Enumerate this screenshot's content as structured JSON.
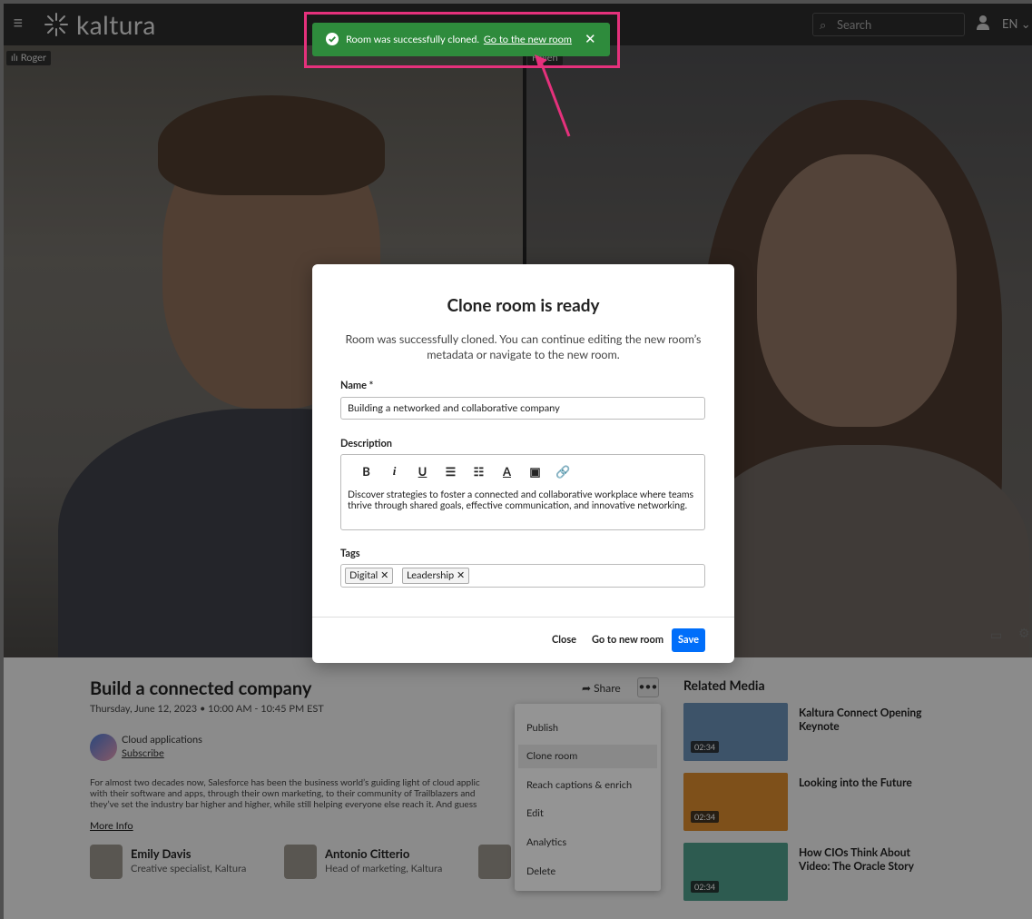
{
  "header": {
    "logo_text": "kaltura",
    "search_placeholder": "Search",
    "language": "EN"
  },
  "video": {
    "left_participant": "Roger",
    "right_participant": "Helen"
  },
  "details": {
    "title": "Build a connected company",
    "date": "Thursday, June 12, 2023  •  10:00 AM - 10:45 PM EST",
    "channel_name": "Cloud applications",
    "subscribe_label": "Subscribe",
    "description_lines": [
      "For almost two decades now, Salesforce has been the business world’s guiding light of cloud applic",
      "with their software and apps, through their own marketing, to their community of Trailblazers and",
      "they’ve set the industry bar higher and higher, while still helping everyone else reach it. And guess"
    ],
    "more_info": "More Info",
    "share_label": "Share",
    "more_label": "•••",
    "people": [
      {
        "name": "Emily Davis",
        "role": "Creative specialist, Kaltura"
      },
      {
        "name": "Antonio Citterio",
        "role": "Head of marketing, Kaltura"
      }
    ]
  },
  "related": {
    "title": "Related Media",
    "items": [
      {
        "title": "Kaltura Connect Opening Keynote",
        "duration": "02:34",
        "color": "#6a8fb5"
      },
      {
        "title": "Looking into the Future",
        "duration": "02:34",
        "color": "#d98a2e"
      },
      {
        "title": "How CIOs Think About Video: The Oracle Story",
        "duration": "02:34",
        "color": "#4e9e8a"
      }
    ]
  },
  "menu": {
    "items": [
      "Publish",
      "Clone room",
      "Reach captions & enrich",
      "Edit",
      "Analytics",
      "Delete"
    ],
    "active": "Clone room"
  },
  "modal": {
    "title": "Clone room is ready",
    "subtitle": "Room was successfully cloned. You can continue editing the new room’s metadata or navigate to the new room.",
    "name_label": "Name *",
    "name_value": "Building a networked and collaborative company",
    "description_label": "Description",
    "description_value": "Discover strategies to foster a connected and collaborative workplace where teams thrive through shared goals, effective communication, and innovative networking.",
    "tags_label": "Tags",
    "tags": [
      "Digital",
      "Leadership"
    ],
    "close_label": "Close",
    "go_label": "Go to new room",
    "save_label": "Save"
  },
  "toast": {
    "message": "Room was successfully cloned.",
    "link": "Go to the new room",
    "close": "✕"
  },
  "colors": {
    "accent": "#006efa",
    "toast_green": "#2e8b3c",
    "highlight": "#e5317c"
  }
}
